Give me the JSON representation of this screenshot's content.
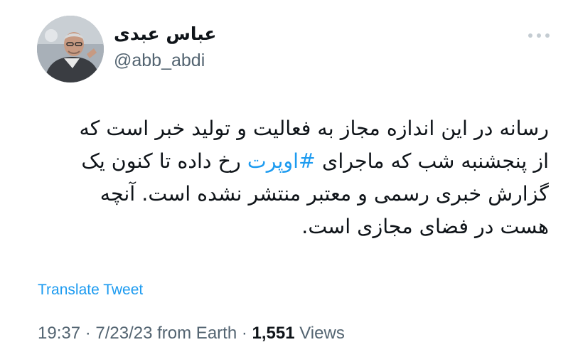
{
  "author": {
    "display_name": "عباس عبدی",
    "handle": "@abb_abdi"
  },
  "menu_icon": "more-horizontal-icon",
  "tweet": {
    "lines": [
      {
        "text": "رسانه در این اندازه مجاز به فعالیت و تولید خبر است که"
      },
      {
        "before": "از پنجشنبه شب که ماجرای ",
        "hashtag": "#اوپرت",
        "after": " رخ داده تا کنون یک"
      },
      {
        "text": "گزارش خبری رسمی و معتبر منتشر نشده است. آنچه"
      },
      {
        "text": "هست در فضای مجازی است."
      }
    ]
  },
  "translate_label": "Translate Tweet",
  "meta": {
    "time": "19:37",
    "separator": " · ",
    "date": "7/23/23",
    "source": " from Earth",
    "views_count": "1,551",
    "views_label": " Views"
  },
  "colors": {
    "link": "#1d9bf0",
    "secondary_text": "#536471",
    "primary_text": "#0f1419"
  }
}
